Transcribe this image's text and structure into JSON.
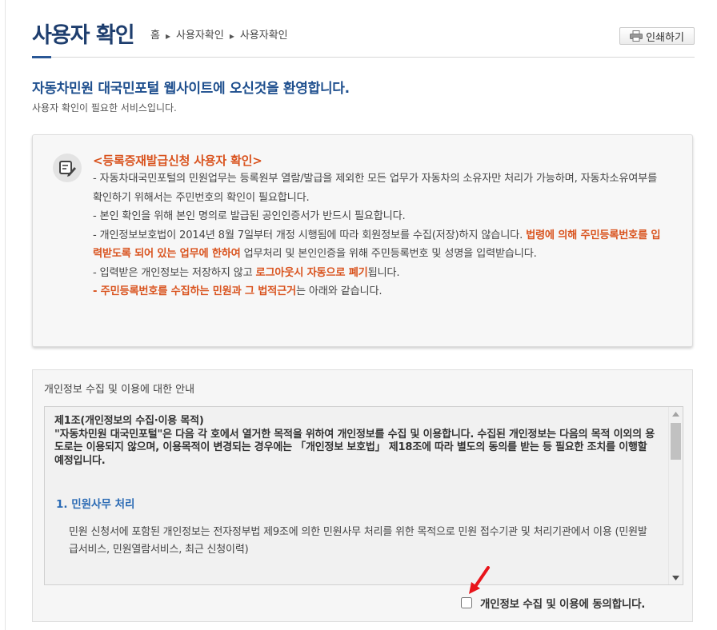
{
  "header": {
    "title": "사용자 확인",
    "breadcrumb": [
      "홈",
      "사용자확인",
      "사용자확인"
    ],
    "print_label": "인쇄하기"
  },
  "welcome": {
    "title": "자동차민원 대국민포털 웹사이트에 오신것을 환영합니다.",
    "subtitle": "사용자 확인이 필요한 서비스입니다."
  },
  "notice": {
    "title": "<등록증재발급신청 사용자 확인>",
    "line1": "- 자동차대국민포털의 민원업무는 등록원부 열람/발급을 제외한 모든 업무가 자동차의 소유자만 처리가 가능하며, 자동차소유여부를 확인하기 위해서는 주민번호의 확인이 필요합니다.",
    "line2": "- 본인 확인을 위해 본인 명의로 발급된 공인인증서가 반드시 필요합니다.",
    "line3_a": "- 개인정보보호법이 2014년 8월 7일부터 개정 시행됨에 따라 회원정보를 수집(저장)하지 않습니다. ",
    "line3_b": "법령에 의해 주민등록번호를 입력받도록 되어 있는 업무에 한하여",
    "line3_c": " 업무처리 및 본인인증을 위해 주민등록번호 및 성명을 입력받습니다.",
    "line4_a": "- 입력받은 개인정보는 저장하지 않고 ",
    "line4_b": "로그아웃시 자동으로 폐기",
    "line4_c": "됩니다.",
    "line5_a": "- 주민등록번호를 수집하는 민원과 그 법적근거",
    "line5_b": "는 아래와 같습니다."
  },
  "privacy": {
    "heading": "개인정보 수집 및 이용에 대한 안내",
    "article_title": "제1조(개인정보의 수집·이용 목적)",
    "article_body": "\"자동차민원 대국민포털\"은 다음 각 호에서 열거한 목적을 위하여 개인정보를 수집 및 이용합니다. 수집된 개인정보는 다음의 목적 이외의 용도로는 이용되지 않으며, 이용목적이 변경되는 경우에는 「개인정보 보호법」 제18조에 따라 별도의 동의를 받는 등 필요한 조치를 이행할 예정입니다.",
    "section1_title": "1. 민원사무 처리",
    "section1_body": "민원 신청서에 포함된 개인정보는 전자정부법 제9조에 의한 민원사무 처리를 위한 목적으로 민원 접수기관 및 처리기관에서 이용 (민원발급서비스, 민원열람서비스, 최근 신청이력)",
    "agree_label": "개인정보 수집 및 이용에 동의합니다.",
    "agree_checked": false
  },
  "icons": {
    "print": "printer-icon",
    "notice": "pencil-note-icon",
    "scroll_up": "triangle-up-icon",
    "scroll_down": "triangle-down-icon",
    "annotation": "red-arrow-icon"
  },
  "colors": {
    "title": "#1e3e6e",
    "accent_orange": "#d9531e",
    "link_blue": "#2a6ab4"
  }
}
